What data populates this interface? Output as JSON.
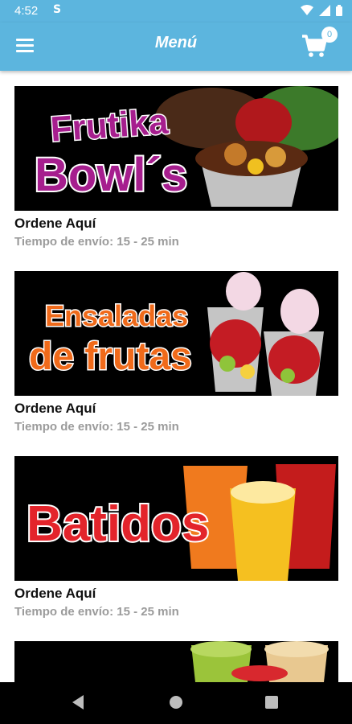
{
  "status_bar": {
    "time": "4:52",
    "notification_icon": "S"
  },
  "app_bar": {
    "title": "Menú",
    "cart_count": "0"
  },
  "menu_items": [
    {
      "banner_text": [
        "Frutika",
        "Bowl´s"
      ],
      "title": "Ordene Aquí",
      "subtitle": "Tiempo de envío: 15 - 25 min"
    },
    {
      "banner_text": [
        "Ensaladas",
        "de frutas"
      ],
      "title": "Ordene Aquí",
      "subtitle": "Tiempo de envío: 15 - 25 min"
    },
    {
      "banner_text": [
        "Batidos"
      ],
      "title": "Ordene Aquí",
      "subtitle": "Tiempo de envío: 15 - 25 min"
    }
  ],
  "colors": {
    "primary": "#5cb5de",
    "bowls_text": "#a61e8e",
    "salad_text": "#f06a1a",
    "batidos_text": "#e3242b"
  }
}
